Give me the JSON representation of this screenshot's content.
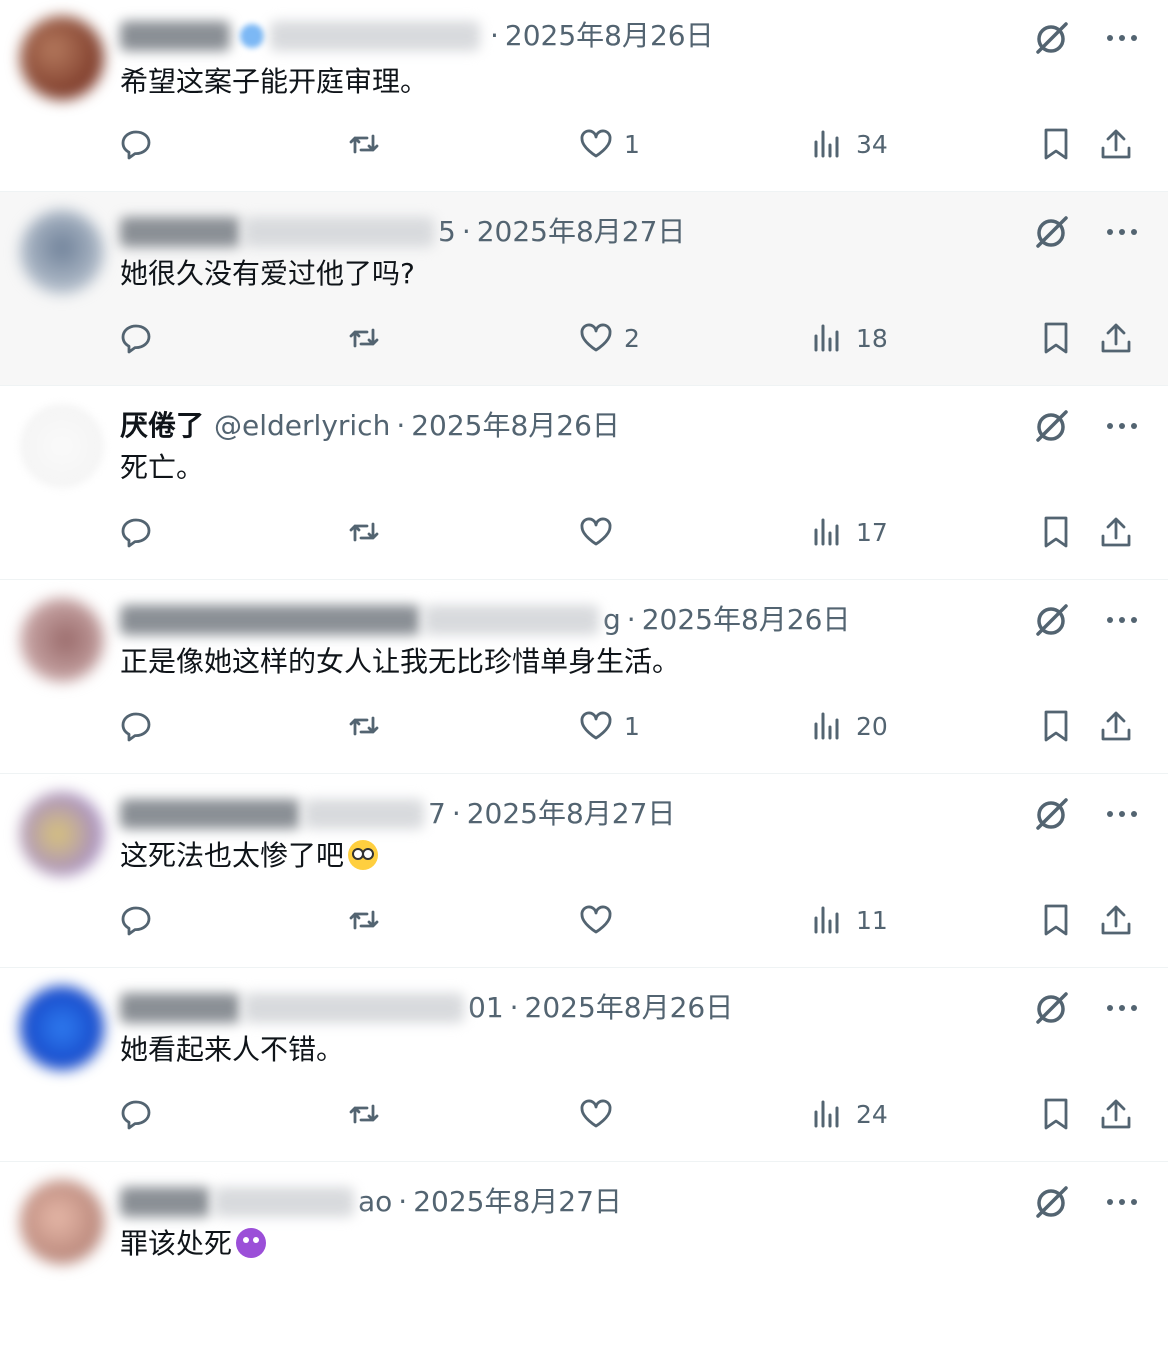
{
  "tweets": [
    {
      "name": "",
      "handle": "",
      "date": "2025年8月26日",
      "text": "希望这案子能开庭审理。",
      "replies": "",
      "retweets": "",
      "likes": "1",
      "views": "34",
      "emoji": ""
    },
    {
      "name": "",
      "handle": "",
      "date": "2025年8月27日",
      "text": "她很久没有爱过他了吗?",
      "replies": "",
      "retweets": "",
      "likes": "2",
      "views": "18",
      "emoji": ""
    },
    {
      "name": "厌倦了",
      "handle": "@elderlyrich",
      "date": "2025年8月26日",
      "text": "死亡。",
      "replies": "",
      "retweets": "",
      "likes": "",
      "views": "17",
      "emoji": ""
    },
    {
      "name": "",
      "handle": "",
      "date": "2025年8月26日",
      "text": "正是像她这样的女人让我无比珍惜单身生活。",
      "replies": "",
      "retweets": "",
      "likes": "1",
      "views": "20",
      "emoji": ""
    },
    {
      "name": "",
      "handle": "",
      "date": "2025年8月27日",
      "text": "这死法也太惨了吧",
      "replies": "",
      "retweets": "",
      "likes": "",
      "views": "11",
      "emoji": "flushed-face"
    },
    {
      "name": "",
      "handle": "",
      "date": "2025年8月26日",
      "text": "她看起来人不错。",
      "replies": "",
      "retweets": "",
      "likes": "",
      "views": "24",
      "emoji": ""
    },
    {
      "name": "",
      "handle": "",
      "date": "2025年8月27日",
      "text": "罪该处死",
      "replies": "",
      "retweets": "",
      "likes": "",
      "views": "",
      "emoji": "smiling-devil"
    }
  ],
  "handle_fragments": [
    "",
    "5",
    "",
    "g",
    "7",
    "01",
    "ao"
  ],
  "separator": "·",
  "colors": {
    "text": "#0f1419",
    "secondary": "#536471",
    "divider": "#eff3f4",
    "highlight_row": "#f7f7f7"
  },
  "icons": [
    "grok-icon",
    "more-icon",
    "reply-icon",
    "retweet-icon",
    "like-icon",
    "views-icon",
    "bookmark-icon",
    "share-icon"
  ]
}
